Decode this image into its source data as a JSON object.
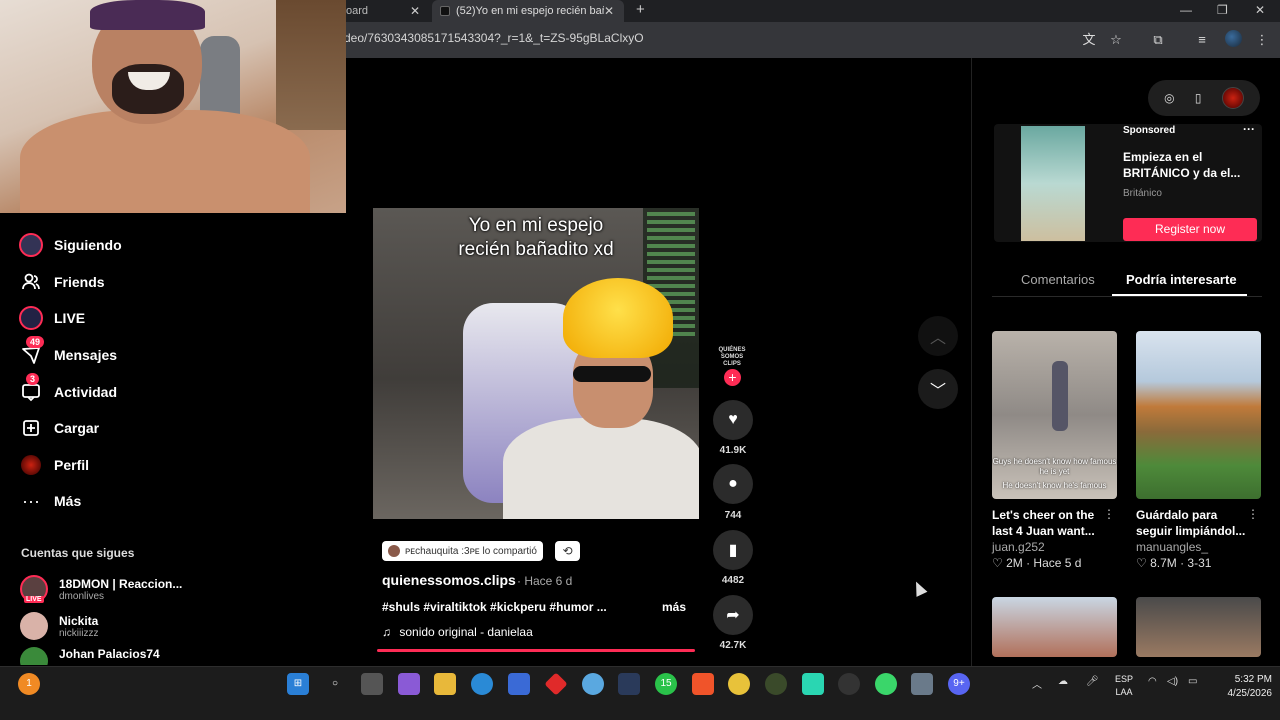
{
  "browser": {
    "tab1_label": "oard",
    "tab2_label": "(52)Yo en mi espejo recién bañ",
    "url": "deo/7630343085171543304?_r=1&_t=ZS-95gBLaClxyO"
  },
  "sidebar": {
    "items": [
      {
        "label": "Siguiendo",
        "icon": "following-avatar-icon"
      },
      {
        "label": "Friends",
        "icon": "friends-icon"
      },
      {
        "label": "LIVE",
        "icon": "live-icon"
      },
      {
        "label": "Mensajes",
        "icon": "messages-icon",
        "badge": "49"
      },
      {
        "label": "Actividad",
        "icon": "activity-icon",
        "badge": "3"
      },
      {
        "label": "Cargar",
        "icon": "upload-icon"
      },
      {
        "label": "Perfil",
        "icon": "profile-icon"
      },
      {
        "label": "Más",
        "icon": "more-icon"
      }
    ],
    "following_title": "Cuentas que sigues",
    "following": [
      {
        "name": "18DMON | Reaccion...",
        "handle": "dmonlives",
        "live": "LIVE"
      },
      {
        "name": "Nickita",
        "handle": "nickiiizzz"
      },
      {
        "name": "Johan Palacios74",
        "handle": ""
      }
    ]
  },
  "video": {
    "caption_line1": "Yo en mi espejo",
    "caption_line2": "recién bañadito xd",
    "shared_by": "ᴘᴇchauquita :3ᴘᴇ lo compartió",
    "author": "quienessomos.clips",
    "ago": " · Hace 6 d",
    "hashtags": "#shuls #viraltiktok #kickperu #humor ...",
    "more": "más",
    "sound": "sonido original - danielaa",
    "creator_badge": "QUIÉNES SOMOS CLIPS",
    "likes": "41.9K",
    "comments": "744",
    "saves": "4482",
    "shares": "42.7K",
    "progress": 1.0
  },
  "right_panel": {
    "ad": {
      "sponsored": "Sponsored",
      "title": "Empieza en el BRITÁNICO y da el...",
      "brand": "Británico",
      "cta": "Register now"
    },
    "tabs": [
      "Comentarios",
      "Podría interesarte"
    ],
    "cards": [
      {
        "title": "Let's cheer on the last 4 Juan want...",
        "author": "juan.g252",
        "meta": "♡ 2M · Hace 5 d",
        "overlay1": "Guys he doesn't know how famous he is yet",
        "overlay2": "He doesn't know he's famous"
      },
      {
        "title": "Guárdalo para seguir limpiándol...",
        "author": "manuangles_",
        "meta": "♡ 8.7M · 3-31"
      }
    ]
  },
  "taskbar": {
    "lang1": "ESP",
    "lang2": "LAA",
    "time": "5:32 PM",
    "date": "4/25/2026",
    "chrome_badge": "1",
    "whatsapp_badge": "15",
    "discord_badge": "9+"
  }
}
